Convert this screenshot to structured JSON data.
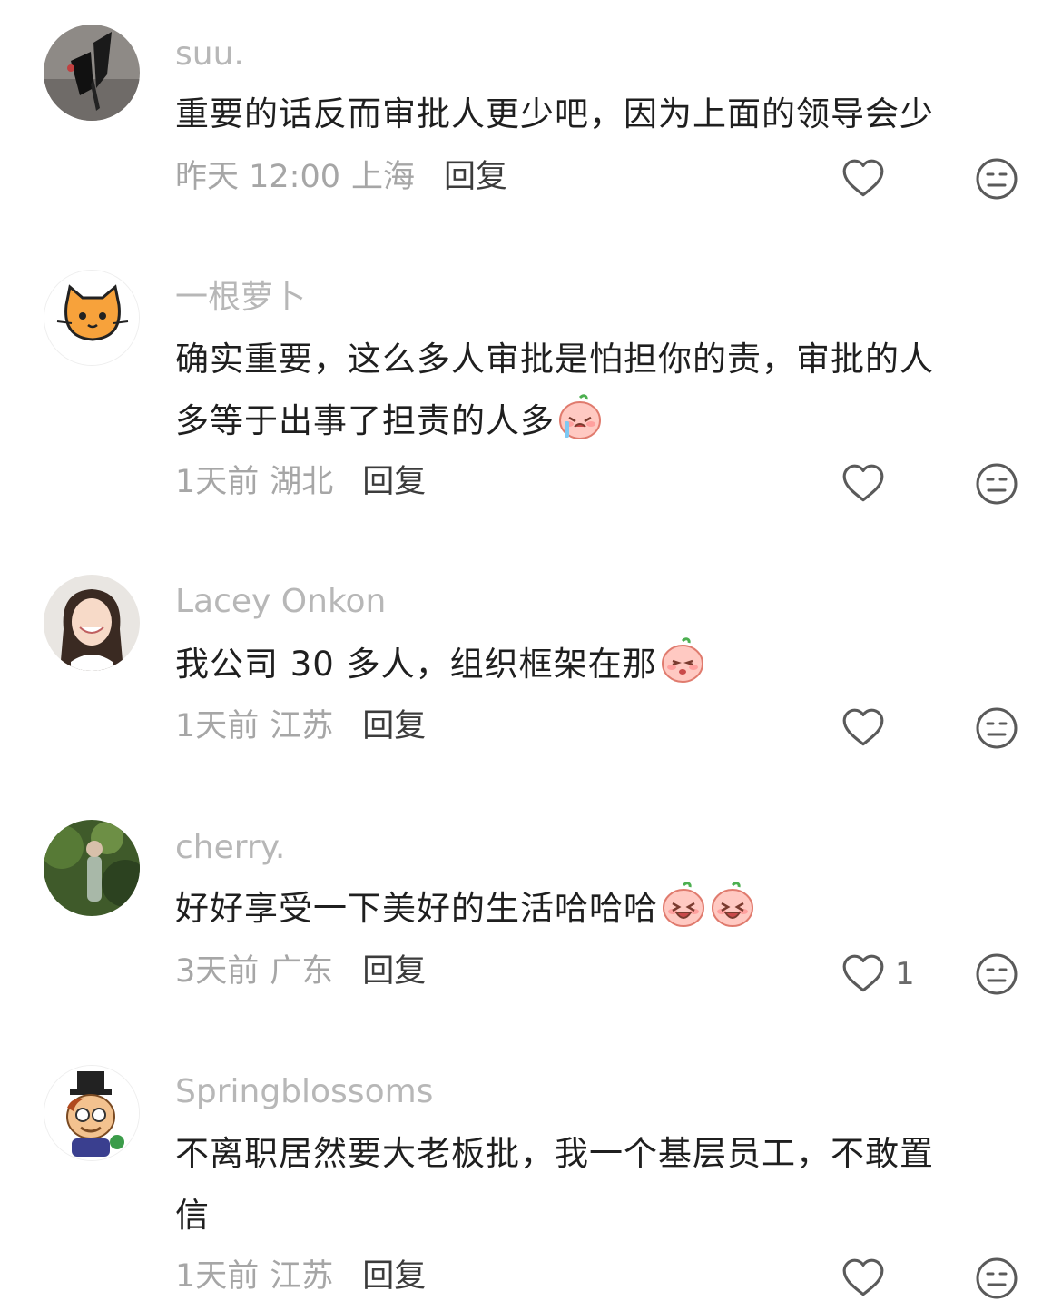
{
  "colors": {
    "username": "#b7b7b7",
    "content": "#1f1f1f",
    "meta": "#a6a6a6",
    "reply": "#3c3c3c",
    "icon": "#5a5a5a"
  },
  "comments": [
    {
      "username": "suu.",
      "avatar_icon": "black-butterfly-photo-avatar",
      "content": [
        "重要的话反而审批人更少吧，因为上面的领导会少"
      ],
      "time": "昨天 12:00",
      "location": "上海",
      "reply_label": "回复",
      "like_count": ""
    },
    {
      "username": "一根萝卜",
      "avatar_icon": "orange-cat-avatar",
      "content": [
        "确实重要，这么多人审批是怕担你的责，审批的人",
        "多等于出事了担责的人多"
      ],
      "emoji": [
        "crying-face-emoji"
      ],
      "time": "1天前",
      "location": "湖北",
      "reply_label": "回复",
      "like_count": ""
    },
    {
      "username": "Lacey Onkon",
      "avatar_icon": "smiling-girl-photo-avatar",
      "content": [
        "我公司 30 多人，组织框架在那"
      ],
      "emoji": [
        "shy-face-emoji"
      ],
      "time": "1天前",
      "location": "江苏",
      "reply_label": "回复",
      "like_count": ""
    },
    {
      "username": "cherry.",
      "avatar_icon": "forest-photo-avatar",
      "content": [
        "好好享受一下美好的生活哈哈哈"
      ],
      "emoji": [
        "laughing-face-emoji",
        "laughing-face-emoji"
      ],
      "time": "3天前",
      "location": "广东",
      "reply_label": "回复",
      "like_count": "1"
    },
    {
      "username": "Springblossoms",
      "avatar_icon": "cartoon-magician-avatar",
      "content": [
        "不离职居然要大老板批，我一个基层员工，不敢置",
        "信"
      ],
      "time": "1天前",
      "location": "江苏",
      "reply_label": "回复",
      "like_count": ""
    }
  ]
}
